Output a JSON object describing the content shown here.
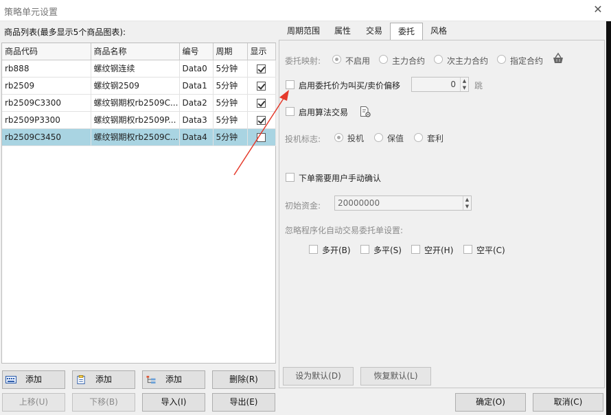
{
  "window": {
    "title": "策略单元设置",
    "close_glyph": "✕"
  },
  "product_list": {
    "label": "商品列表(最多显示5个商品图表):",
    "columns": [
      "商品代码",
      "商品名称",
      "编号",
      "周期",
      "显示"
    ],
    "rows": [
      {
        "code": "rb888",
        "name": "螺纹钢连续",
        "id": "Data0",
        "period": "5分钟",
        "show": true,
        "selected": false
      },
      {
        "code": "rb2509",
        "name": "螺纹钢2509",
        "id": "Data1",
        "period": "5分钟",
        "show": true,
        "selected": false
      },
      {
        "code": "rb2509C3300",
        "name": "螺纹钢期权rb2509C...",
        "id": "Data2",
        "period": "5分钟",
        "show": true,
        "selected": false
      },
      {
        "code": "rb2509P3300",
        "name": "螺纹钢期权rb2509P...",
        "id": "Data3",
        "period": "5分钟",
        "show": true,
        "selected": false
      },
      {
        "code": "rb2509C3450",
        "name": "螺纹钢期权rb2509C...",
        "id": "Data4",
        "period": "5分钟",
        "show": false,
        "selected": true
      }
    ]
  },
  "buttons": {
    "add1": "添加",
    "add2": "添加",
    "add3": "添加",
    "delete": "删除(R)",
    "move_up": "上移(U)",
    "move_down": "下移(B)",
    "import": "导入(I)",
    "export": "导出(E)",
    "set_default": "设为默认(D)",
    "restore_default": "恢复默认(L)",
    "ok": "确定(O)",
    "cancel": "取消(C)"
  },
  "tabs": [
    "周期范围",
    "属性",
    "交易",
    "委托",
    "风格"
  ],
  "active_tab": "委托",
  "order_tab": {
    "mapping_label": "委托映射:",
    "mapping_options": [
      "不启用",
      "主力合约",
      "次主力合约",
      "指定合约"
    ],
    "mapping_selected": "不启用",
    "price_offset_label": "启用委托价为叫买/卖价偏移",
    "price_offset_value": "0",
    "price_offset_unit": "跳",
    "algo_label": "启用算法交易",
    "spec_label": "投机标志:",
    "spec_options": [
      "投机",
      "保值",
      "套利"
    ],
    "spec_selected": "投机",
    "manual_confirm_label": "下单需要用户手动确认",
    "capital_label": "初始资金:",
    "capital_value": "20000000",
    "ignore_label": "忽略程序化自动交易委托单设置:",
    "ignore_options": [
      "多开(B)",
      "多平(S)",
      "空开(H)",
      "空平(C)"
    ]
  },
  "colors": {
    "selection": "#a9d4e2",
    "annotation_arrow": "#e53a2b",
    "background": "#f0f0f0"
  }
}
